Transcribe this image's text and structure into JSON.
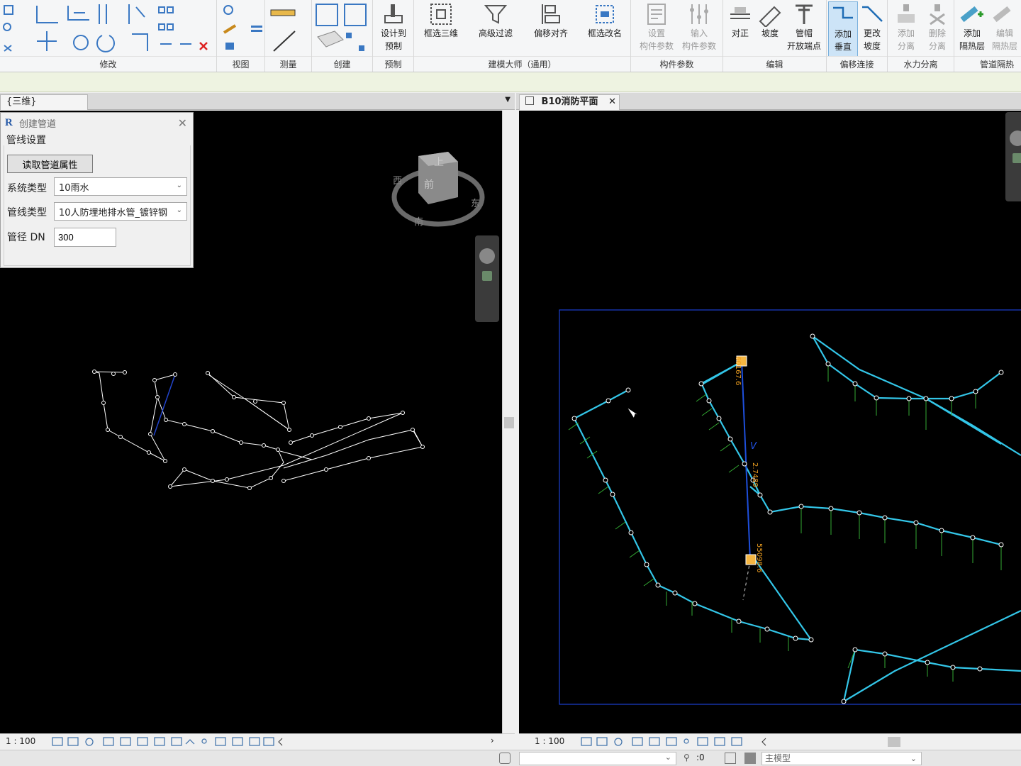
{
  "ribbon": {
    "groups": {
      "modify": "修改",
      "view": "视图",
      "measure": "测量",
      "create": "创建",
      "prefab": "预制",
      "jianmo": "建模大师（通用）",
      "component_params": "构件参数",
      "edit": "编辑",
      "offset_connect": "偏移连接",
      "hydraulic": "水力分离",
      "insulation": "管道隔热层"
    },
    "buttons": {
      "design_to_prefab_1": "设计到",
      "design_to_prefab_2": "预制",
      "box_3d": "框选三维",
      "adv_filter": "高级过滤",
      "offset_align": "偏移对齐",
      "box_rename": "框选改名",
      "set_params_1": "设置",
      "set_params_2": "构件参数",
      "input_params_1": "输入",
      "input_params_2": "构件参数",
      "align": "对正",
      "slope": "坡度",
      "cap_1": "管帽",
      "cap_2": "开放端点",
      "add_vertical_1": "添加",
      "add_vertical_2": "垂直",
      "change_slope_1": "更改",
      "change_slope_2": "坡度",
      "add_sep_1": "添加",
      "add_sep_2": "分离",
      "del_sep_1": "删除",
      "del_sep_2": "分离",
      "add_ins_1": "添加",
      "add_ins_2": "隔热层",
      "edit_ins_1": "编辑",
      "edit_ins_2": "隔热层"
    }
  },
  "left_view": {
    "tab": "{三维}",
    "scale": "1 : 100",
    "viewcube": {
      "face": "上",
      "face2": "前",
      "south": "南",
      "east": "东",
      "west": "西"
    }
  },
  "right_view": {
    "tab": "B10消防平面",
    "scale": "1 : 100",
    "annotations": {
      "elev_top": "60167.6",
      "elev_mid": "2.7489",
      "elev_bot": "55098.6",
      "v_label": "V"
    }
  },
  "dialog": {
    "title": "创建管道",
    "section": "管线设置",
    "read_button": "读取管道属性",
    "system_type_label": "系统类型",
    "system_type_value": "10雨水",
    "pipe_type_label": "管线类型",
    "pipe_type_value": "10人防埋地排水管_镀锌钢",
    "dn_label": "管径 DN",
    "dn_value": "300"
  },
  "statusbar": {
    "zero": ":0",
    "model": "主模型"
  },
  "colors": {
    "pipe": "#33c6e8",
    "branch": "#33aa33",
    "frame": "#1a3fd0"
  }
}
